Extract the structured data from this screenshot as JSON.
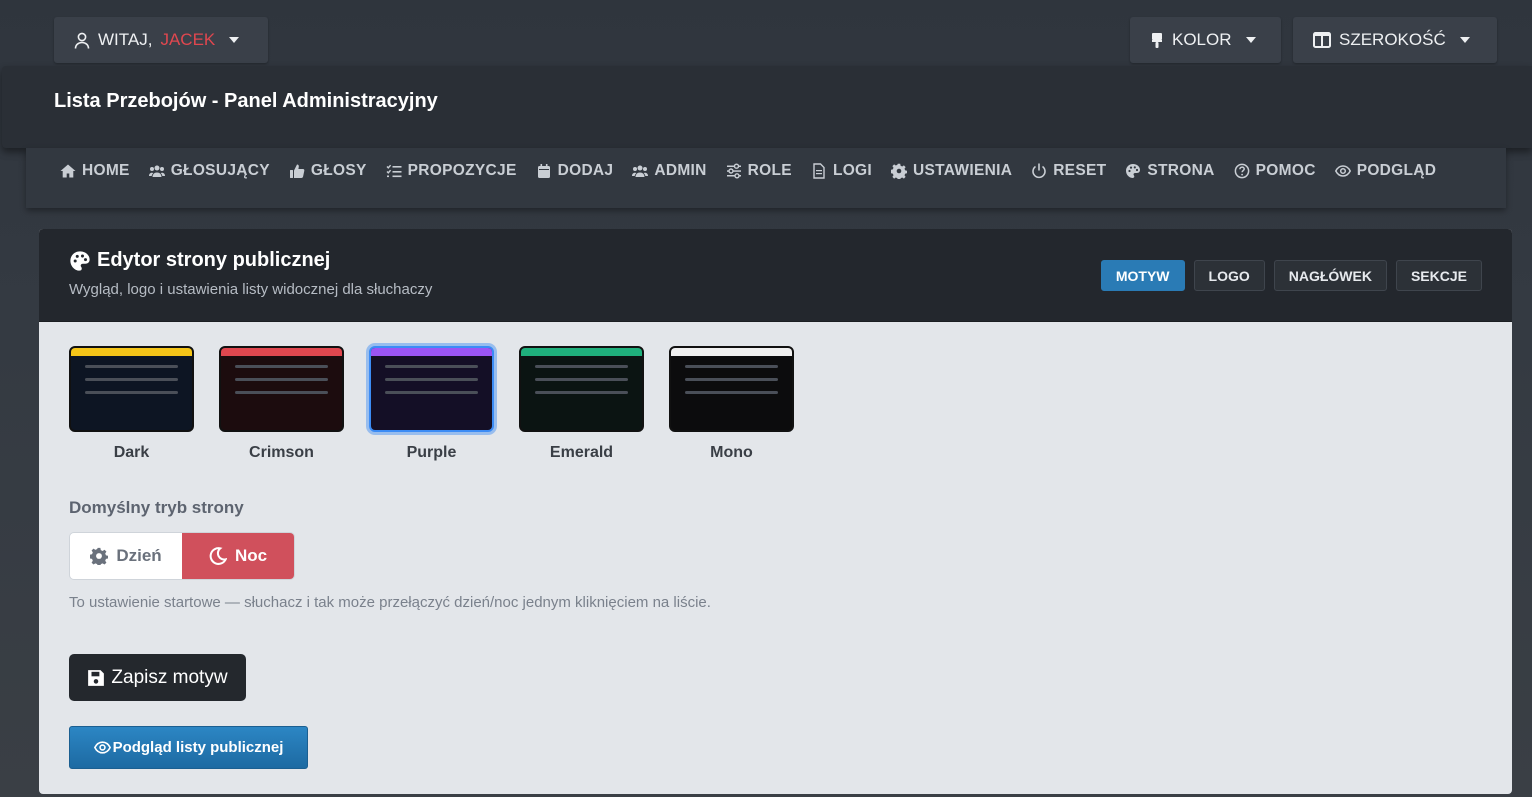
{
  "topbar": {
    "greeting": "WITAJ,",
    "user_name": "JACEK",
    "color_label": "KOLOR",
    "width_label": "SZEROKOŚĆ"
  },
  "app_title": "Lista Przebojów - Panel Administracyjny",
  "nav": [
    {
      "label": "HOME",
      "icon": "home-icon"
    },
    {
      "label": "GŁOSUJĄCY",
      "icon": "users-icon"
    },
    {
      "label": "GŁOSY",
      "icon": "thumbs-up-icon"
    },
    {
      "label": "PROPOZYCJE",
      "icon": "list-check-icon"
    },
    {
      "label": "DODAJ",
      "icon": "calendar-icon"
    },
    {
      "label": "ADMIN",
      "icon": "users-cog-icon"
    },
    {
      "label": "ROLE",
      "icon": "sliders-icon"
    },
    {
      "label": "LOGI",
      "icon": "file-icon"
    },
    {
      "label": "USTAWIENIA",
      "icon": "gear-icon"
    },
    {
      "label": "RESET",
      "icon": "power-icon"
    },
    {
      "label": "STRONA",
      "icon": "palette-icon"
    },
    {
      "label": "POMOC",
      "icon": "question-icon"
    },
    {
      "label": "PODGLĄD",
      "icon": "eye-icon"
    }
  ],
  "editor": {
    "title": "Edytor strony publicznej",
    "subtitle": "Wygląd, logo i ustawienia listy widocznej dla słuchaczy",
    "tabs": [
      {
        "label": "MOTYW",
        "active": true
      },
      {
        "label": "LOGO",
        "active": false
      },
      {
        "label": "NAGŁÓWEK",
        "active": false
      },
      {
        "label": "SEKCJE",
        "active": false
      }
    ],
    "themes": [
      {
        "name": "Dark",
        "accent": "#f5c518",
        "bg": "#0d1523",
        "selected": false
      },
      {
        "name": "Crimson",
        "accent": "#e0474f",
        "bg": "#1c0c0e",
        "selected": false
      },
      {
        "name": "Purple",
        "accent": "#9b55f5",
        "bg": "#140f26",
        "selected": true
      },
      {
        "name": "Emerald",
        "accent": "#1fb07c",
        "bg": "#0b1412",
        "selected": false
      },
      {
        "name": "Mono",
        "accent": "#f0f0f0",
        "bg": "#0c0c0d",
        "selected": false
      }
    ],
    "mode_label": "Domyślny tryb strony",
    "mode_day": "Dzień",
    "mode_night": "Noc",
    "mode_selected": "Noc",
    "hint": "To ustawienie startowe — słuchacz i tak może przełączyć dzień/noc jednym kliknięciem na liście.",
    "save_label": "Zapisz motyw",
    "preview_label": "Podgląd listy publicznej"
  }
}
